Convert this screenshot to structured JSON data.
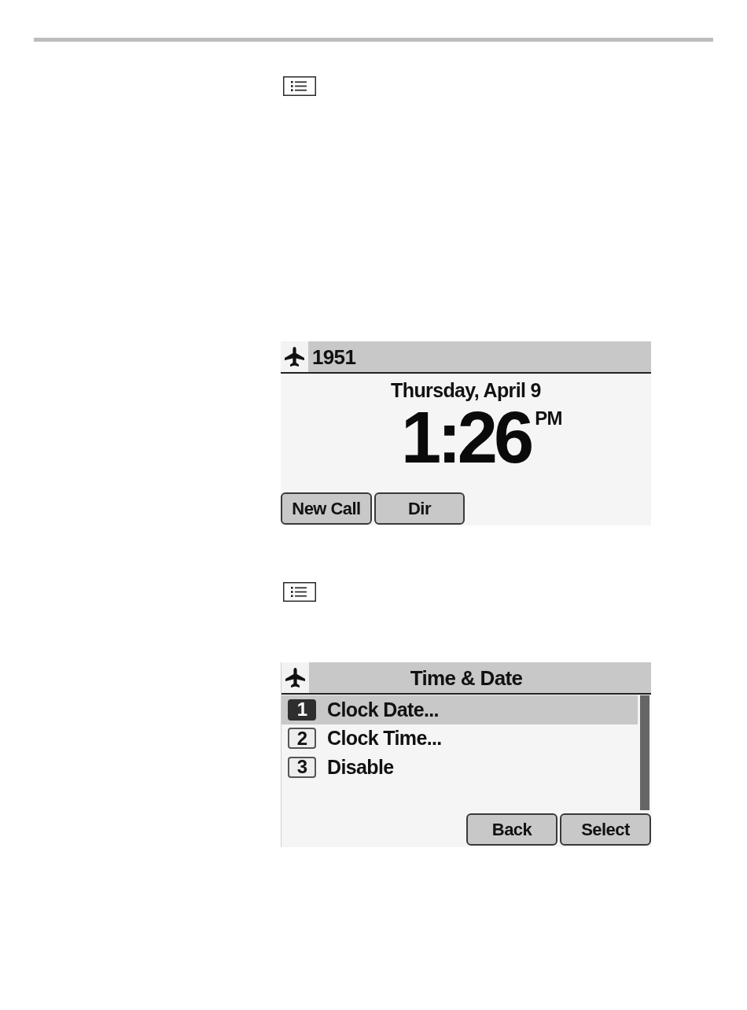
{
  "screens": [
    {
      "kind": "idle",
      "header": {
        "extension": "1951"
      },
      "date": "Thursday, April 9",
      "time": "1:26",
      "meridiem": "PM",
      "softkeys": [
        "New Call",
        "Dir"
      ]
    },
    {
      "kind": "menu",
      "header": {
        "title": "Time & Date"
      },
      "items": [
        {
          "number": "1",
          "label": "Clock Date...",
          "selected": true
        },
        {
          "number": "2",
          "label": "Clock Time...",
          "selected": false
        },
        {
          "number": "3",
          "label": "Disable",
          "selected": false
        }
      ],
      "softkeys": [
        "Back",
        "Select"
      ]
    }
  ]
}
